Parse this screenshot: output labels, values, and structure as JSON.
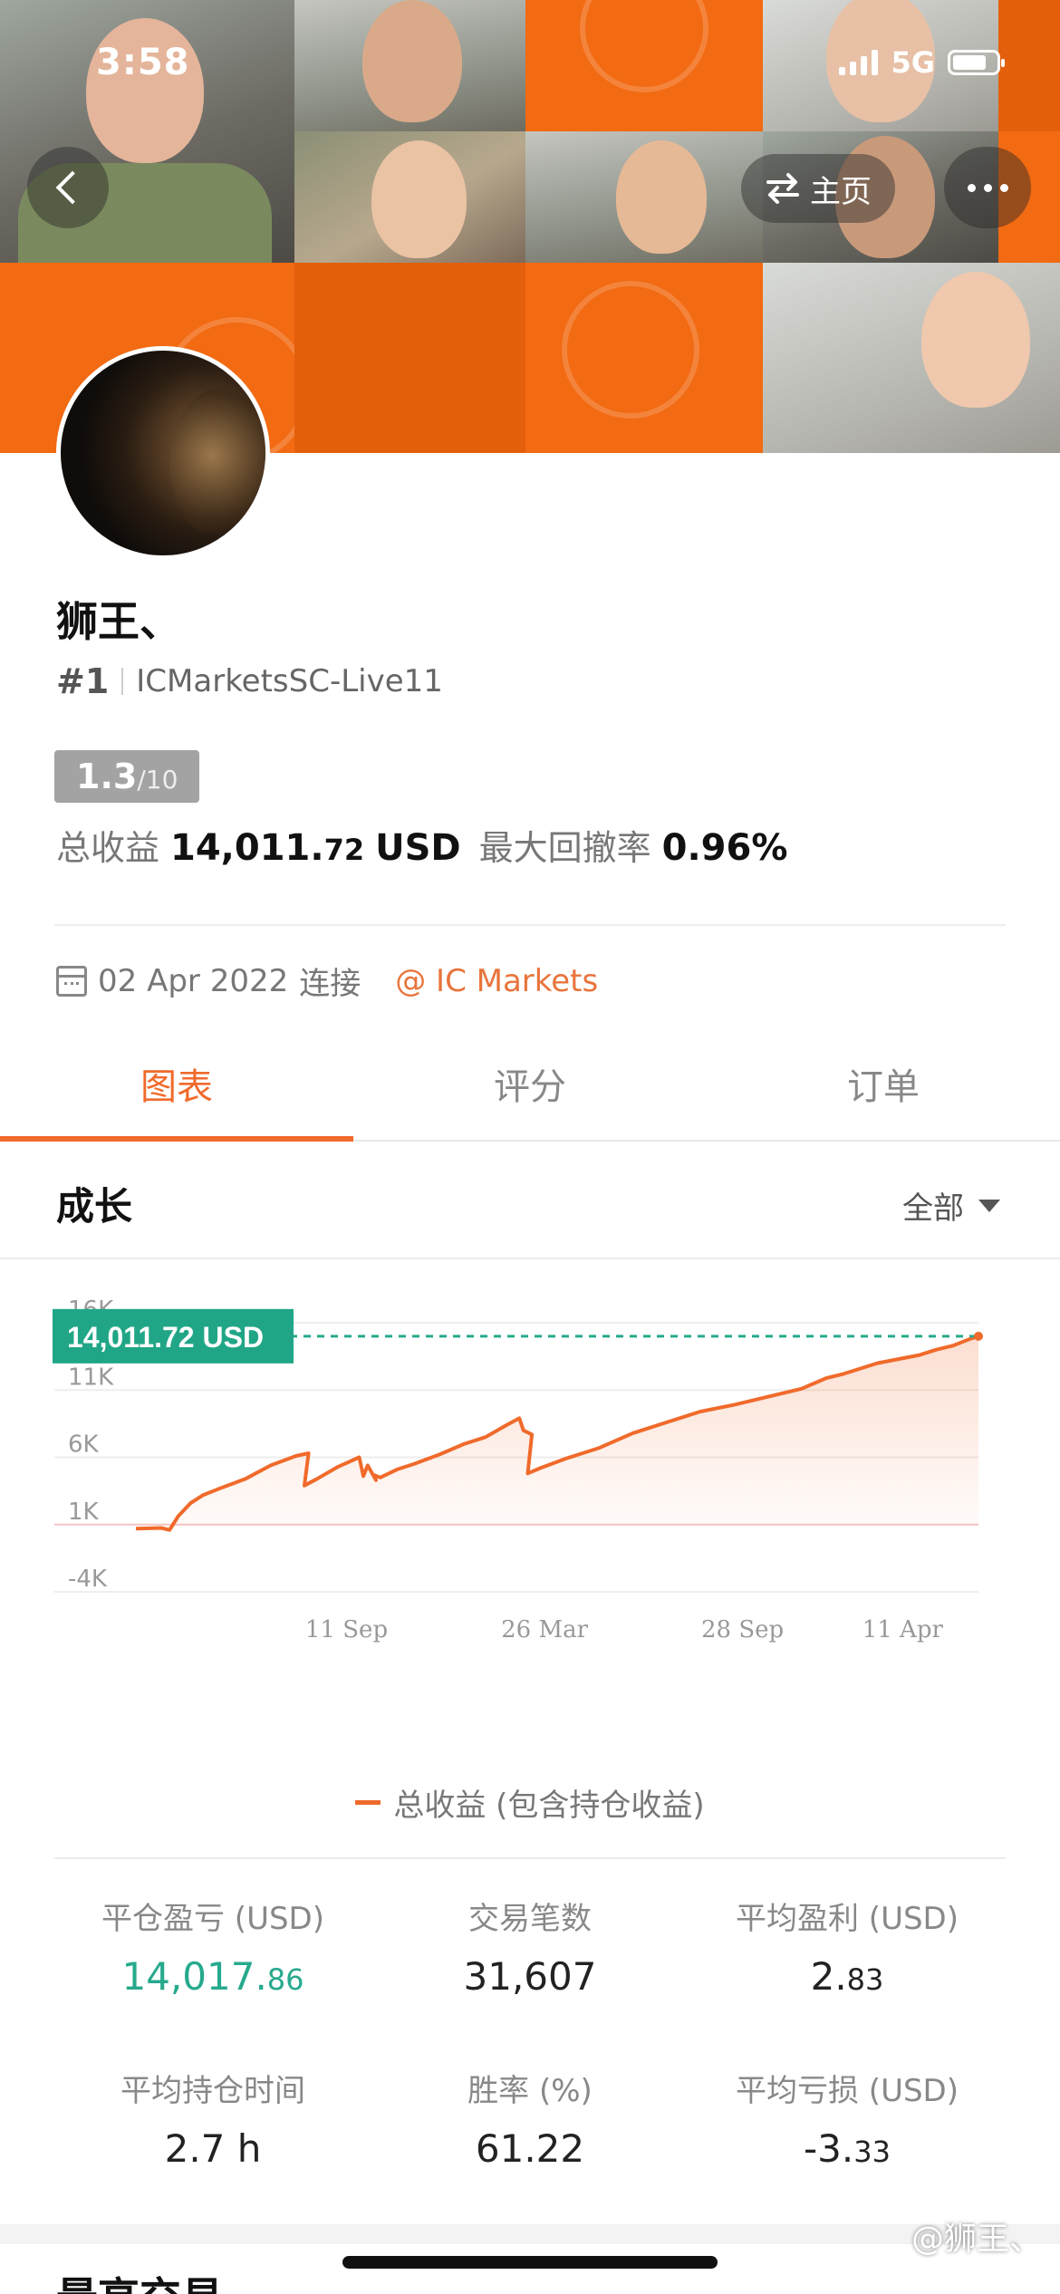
{
  "status_bar": {
    "time": "3:58",
    "network": "5G"
  },
  "header": {
    "home_label": "主页"
  },
  "profile": {
    "name": "狮王、",
    "rank": "#1",
    "server": "ICMarketsSC-Live11",
    "score": "1.3",
    "score_max": "/10",
    "total_profit_label": "总收益",
    "total_profit_main": "14,011.",
    "total_profit_cents": "72",
    "total_profit_unit": "USD",
    "max_drawdown_label": "最大回撤率",
    "max_drawdown": "0.96%",
    "connect_date": "02 Apr 2022",
    "connect_label": "连接",
    "broker": "@ IC Markets"
  },
  "tabs": [
    "图表",
    "评分",
    "订单"
  ],
  "section": {
    "title": "成长",
    "filter": "全部"
  },
  "chart_data": {
    "type": "area",
    "title": "",
    "xlabel": "",
    "ylabel": "",
    "ylim": [
      -4000,
      16000
    ],
    "yticks": [
      "16K",
      "11K",
      "6K",
      "1K",
      "-4K"
    ],
    "xticks": [
      "11 Sep",
      "26 Mar",
      "28 Sep",
      "11 Apr"
    ],
    "current_label": "14,011.72 USD",
    "series": [
      {
        "name": "总收益 (包含持仓收益)",
        "color": "#f06a2b",
        "x": [
          0.0,
          0.03,
          0.04,
          0.05,
          0.065,
          0.08,
          0.1,
          0.13,
          0.16,
          0.19,
          0.205,
          0.2,
          0.215,
          0.24,
          0.265,
          0.27,
          0.275,
          0.285,
          0.282,
          0.29,
          0.31,
          0.33,
          0.36,
          0.39,
          0.415,
          0.44,
          0.455,
          0.46,
          0.47,
          0.465,
          0.48,
          0.51,
          0.55,
          0.59,
          0.63,
          0.67,
          0.71,
          0.75,
          0.79,
          0.82,
          0.84,
          0.86,
          0.88,
          0.905,
          0.93,
          0.95,
          0.97,
          0.99,
          1.0
        ],
        "y": [
          700,
          750,
          600,
          1600,
          2600,
          3200,
          3700,
          4400,
          5400,
          6100,
          6300,
          3900,
          4400,
          5300,
          6000,
          4600,
          5400,
          4300,
          4700,
          4500,
          5100,
          5500,
          6200,
          7000,
          7500,
          8400,
          8900,
          8000,
          7700,
          4800,
          5200,
          5900,
          6700,
          7800,
          8600,
          9400,
          9900,
          10500,
          11100,
          11900,
          12200,
          12600,
          13000,
          13300,
          13600,
          14000,
          14300,
          14800,
          15000
        ]
      }
    ]
  },
  "legend_label": "总收益 (包含持仓收益)",
  "metrics": [
    {
      "label": "平仓盈亏 (USD)",
      "main": "14,017.",
      "cents": "86",
      "green": true
    },
    {
      "label": "交易笔数",
      "main": "31,607",
      "cents": "",
      "green": false
    },
    {
      "label": "平均盈利 (USD)",
      "main": "2.",
      "cents": "83",
      "green": false
    },
    {
      "label": "平均持仓时间",
      "main": "2.7 h",
      "cents": "",
      "green": false
    },
    {
      "label": "胜率 (%)",
      "main": "61.22",
      "cents": "",
      "green": false
    },
    {
      "label": "平均亏损 (USD)",
      "main": "-3.",
      "cents": "33",
      "green": false
    }
  ],
  "next_section_title": "最高交易",
  "watermark": "@狮王、"
}
